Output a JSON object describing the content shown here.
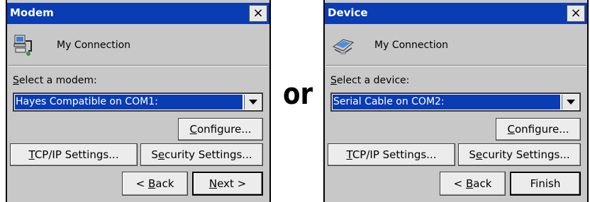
{
  "left": {
    "title": "Modem",
    "close_label": "×",
    "connection_name": "My Connection",
    "select_label_first": "S",
    "select_label_rest": "elect a modem:",
    "combo_value": "Hayes Compatible on COM1:",
    "configure_label_pre": "",
    "configure_label_ul": "C",
    "configure_label_post": "onfigure...",
    "tcpip_label_ul": "T",
    "tcpip_label_post": "CP/IP Settings...",
    "security_label_pre": "S",
    "security_label_ul": "e",
    "security_label_post": "curity Settings...",
    "back_label_pre": "< ",
    "back_label_ul": "B",
    "back_label_post": "ack",
    "next_label_ul": "N",
    "next_label_post": "ext >"
  },
  "separator": "or",
  "right": {
    "title": "Device",
    "close_label": "×",
    "connection_name": "My Connection",
    "select_label_first": "S",
    "select_label_rest": "elect a device:",
    "combo_value": "Serial Cable on COM2:",
    "configure_label_ul": "C",
    "configure_label_post": "onfigure...",
    "tcpip_label_ul": "T",
    "tcpip_label_post": "CP/IP Settings...",
    "security_label_pre": "S",
    "security_label_ul": "e",
    "security_label_post": "curity Settings...",
    "back_label_pre": "< ",
    "back_label_ul": "B",
    "back_label_post": "ack",
    "finish_label": "Finish"
  },
  "colors": {
    "titlebar": "#0a3cb3",
    "dialog_bg": "#c8c8c8",
    "selection": "#0a3cb3"
  },
  "icons": {
    "left_connection": "modem-connection-icon",
    "right_connection": "device-connection-icon"
  }
}
